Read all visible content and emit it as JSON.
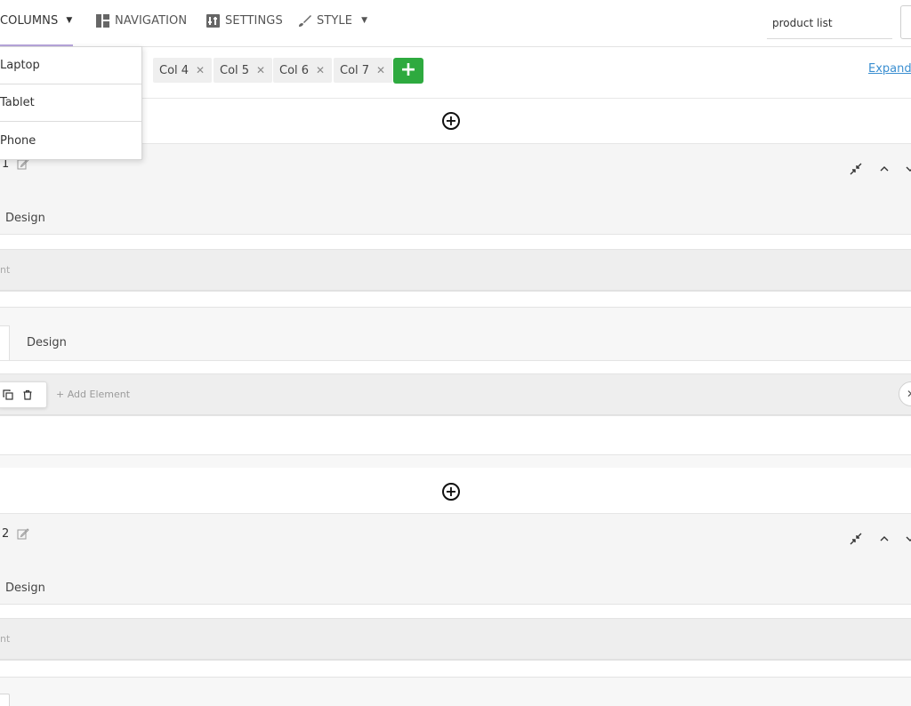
{
  "toolbar": {
    "columns_label": "COLUMNS",
    "navigation_label": "NAVIGATION",
    "settings_label": "SETTINGS",
    "style_label": "STYLE",
    "search_value": "product list"
  },
  "columns_menu": {
    "items": [
      {
        "label": "Laptop"
      },
      {
        "label": "Tablet"
      },
      {
        "label": "Phone"
      }
    ]
  },
  "column_chips": [
    {
      "label": "Col 4"
    },
    {
      "label": "Col 5"
    },
    {
      "label": "Col 6"
    },
    {
      "label": "Col 7"
    }
  ],
  "add_column_label": "+",
  "expand_label": "Expand",
  "sections": [
    {
      "title": "1",
      "tab_label": "Design",
      "faint_text": "nt"
    },
    {
      "title": "2",
      "tab_label": "Design",
      "faint_text": "nt"
    }
  ],
  "row": {
    "tab_label": "Design",
    "add_element_label": "+ Add Element"
  },
  "colors": {
    "accent_green": "#2eaa3f",
    "link_blue": "#3b8fd1",
    "underline_purple": "#b7a6dc"
  }
}
